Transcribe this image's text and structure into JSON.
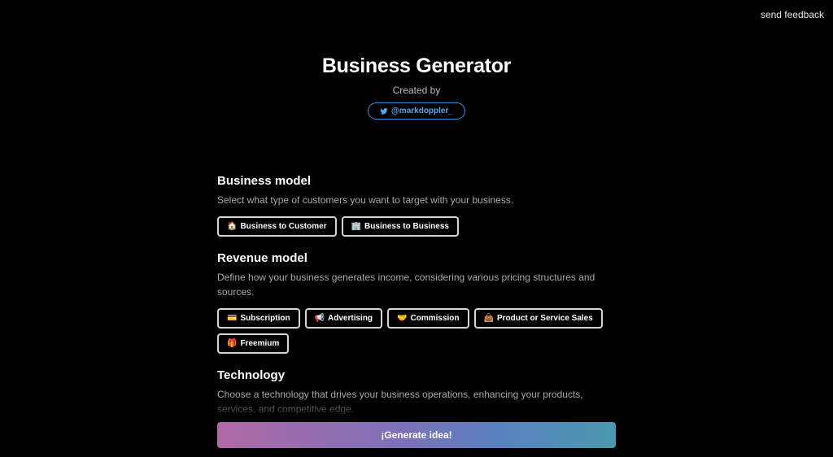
{
  "feedback_label": "send feedback",
  "header": {
    "title": "Business Generator",
    "created_by": "Created by",
    "twitter_handle": "@markdoppler_"
  },
  "sections": {
    "business_model": {
      "title": "Business model",
      "description": "Select what type of customers you want to target with your business.",
      "options": [
        {
          "emoji": "🏠",
          "label": "Business to Customer"
        },
        {
          "emoji": "🏢",
          "label": "Business to Business"
        }
      ]
    },
    "revenue_model": {
      "title": "Revenue model",
      "description": "Define how your business generates income, considering various pricing structures and sources.",
      "options": [
        {
          "emoji": "💳",
          "label": "Subscription"
        },
        {
          "emoji": "📢",
          "label": "Advertising"
        },
        {
          "emoji": "🤝",
          "label": "Commission"
        },
        {
          "emoji": "👜",
          "label": "Product or Service Sales"
        },
        {
          "emoji": "🎁",
          "label": "Freemium"
        }
      ]
    },
    "technology": {
      "title": "Technology",
      "description": "Choose a technology that drives your business operations, enhancing your products, services, and competitive edge."
    }
  },
  "generate_label": "¡Generate idea!",
  "colors": {
    "background": "#000000",
    "twitter_blue": "#5aa8ec",
    "generate_gradient_start": "#b06aa6",
    "generate_gradient_end": "#4a9aae"
  }
}
